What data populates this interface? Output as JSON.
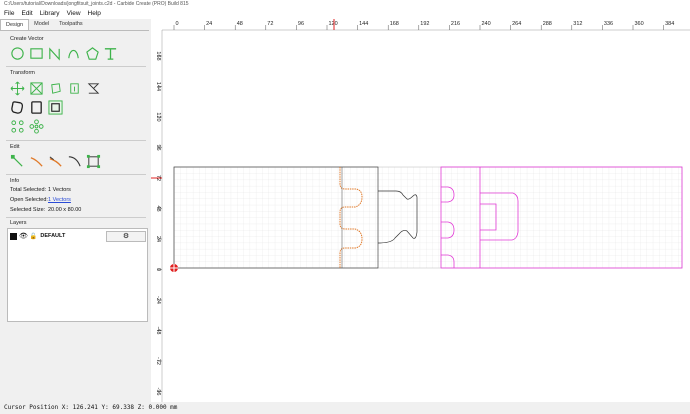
{
  "window": {
    "title": "C:/Users/tutorial/Downloads/jongfitsuit_joints.c2d - Carbide Create (PRO) Build 815"
  },
  "menu": {
    "items": [
      "File",
      "Edit",
      "Library",
      "View",
      "Help"
    ]
  },
  "tabs": [
    "Design",
    "Model",
    "Toolpaths"
  ],
  "sections": {
    "create_vector": "Create Vector",
    "transform": "Transform",
    "edit": "Edit",
    "info": "Info",
    "layers": "Layers"
  },
  "info": {
    "total_selected_label": "Total Selected:",
    "total_selected_value": "1 Vectors",
    "open_selected_label": "Open Selected:",
    "open_selected_value": "1 Vectors",
    "selected_size_label": "Selected Size:",
    "selected_size_value": "20.00 x 80.00"
  },
  "layers": [
    {
      "name": "DEFAULT",
      "color": "#111111"
    }
  ],
  "ruler": {
    "h_ticks": [
      "0",
      "24",
      "48",
      "72",
      "96",
      "120",
      "144",
      "168",
      "192",
      "216",
      "240",
      "264",
      "288",
      "312",
      "336",
      "360",
      "384"
    ],
    "v_ticks": [
      "168",
      "144",
      "120",
      "96",
      "72",
      "48",
      "24",
      "0",
      "-24",
      "-48",
      "-72",
      "-96"
    ]
  },
  "status": {
    "cursor": "Cursor Position X: 126.241 Y: 69.338 Z: 0.000 mm"
  },
  "colors": {
    "accent_green": "#3db34a",
    "orange_vector": "#e07a2a",
    "magenta_vector": "#e23bd6",
    "ruler_marker": "#e02020"
  }
}
